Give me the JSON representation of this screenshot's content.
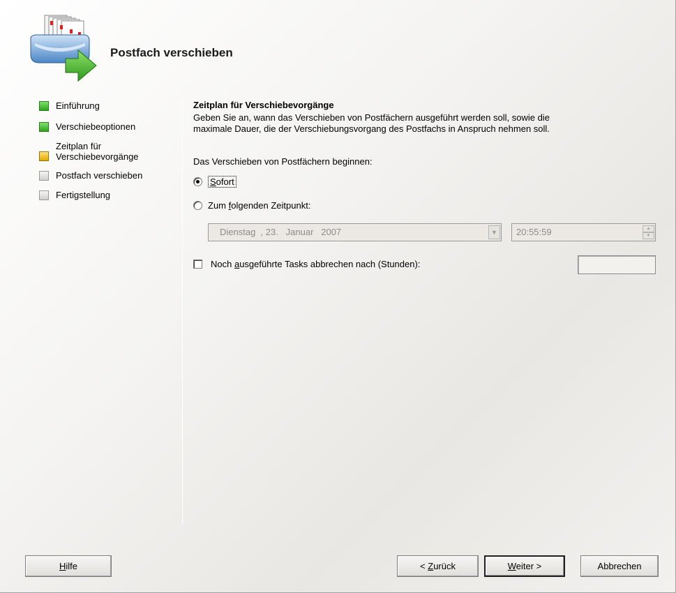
{
  "header": {
    "title": "Postfach verschieben"
  },
  "steps": [
    {
      "label": "Einführung",
      "state": "done"
    },
    {
      "label": "Verschiebeoptionen",
      "state": "done"
    },
    {
      "label_line1": "Zeitplan für",
      "label_line2": "Verschiebevorgänge",
      "state": "current"
    },
    {
      "label": "Postfach verschieben",
      "state": "todo"
    },
    {
      "label": "Fertigstellung",
      "state": "todo"
    }
  ],
  "page": {
    "section_title": "Zeitplan für Verschiebevorgänge",
    "description_line1": "Geben Sie an, wann das Verschieben von Postfächern ausgeführt werden soll, sowie die",
    "description_line2": "maximale Dauer, die der Verschiebungsvorgang des Postfachs in Anspruch nehmen soll.",
    "begin_label": "Das Verschieben von Postfächern beginnen:",
    "radio_immediately": {
      "label_pre": "",
      "label_u": "S",
      "label_post": "ofort",
      "checked": true
    },
    "radio_at_time": {
      "label_pre": "Zum ",
      "label_u": "f",
      "label_post": "olgenden Zeitpunkt:",
      "checked": false
    },
    "date_value": "Dienstag  , 23.   Januar   2007",
    "time_value": "20:55:59",
    "cancel_tasks": {
      "label_pre": "Noch ",
      "label_u": "a",
      "label_post": "usgeführte Tasks abbrechen nach (Stunden):",
      "checked": false
    },
    "hours_value": ""
  },
  "buttons": {
    "help": {
      "u": "H",
      "rest": "ilfe"
    },
    "back": {
      "pre": "< ",
      "u": "Z",
      "rest": "urück"
    },
    "next": {
      "u": "W",
      "rest": "eiter >"
    },
    "cancel": "Abbrechen"
  },
  "colors": {
    "step_done": "#2fa51c",
    "step_current": "#e2a800",
    "step_todo": "#cfcfcf"
  }
}
